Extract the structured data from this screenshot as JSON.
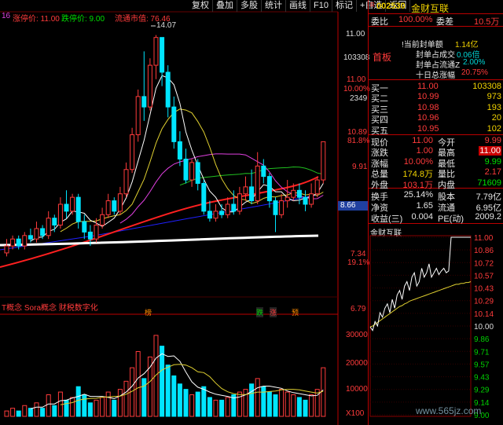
{
  "toolbar": [
    "复权",
    "叠加",
    "多股",
    "统计",
    "画线",
    "F10",
    "标记",
    "+自选",
    "返回"
  ],
  "header": {
    "prefix": "16",
    "limit_up": "涨停价: 11.00",
    "limit_down": "跌停价: 9.00",
    "circ_cap": "流通市值: 76.46"
  },
  "price_axis": {
    "labels": [
      "11.00",
      "103308",
      "11.00",
      "10.00%",
      "2349",
      "10.89",
      "81.8%",
      "9.91",
      "8.66",
      "7.34",
      "19.1%",
      "6.79"
    ]
  },
  "peak_label": "14.07",
  "indicator_text": "T概念 Sora概念 财税数字化",
  "event_markers": [
    "榜",
    "跌",
    "涨",
    "预"
  ],
  "volume_axis": [
    "30000",
    "20000",
    "10000",
    "X100"
  ],
  "colors": {
    "up": "#ff3b3b",
    "down": "#00e5ff",
    "ma5": "#ffffff",
    "ma10": "#e0d030",
    "ma20": "#e040e0",
    "ma60": "#20c020",
    "ma120": "#ff2020",
    "ma250": "#2020ff"
  },
  "chart_data": {
    "type": "candlestick",
    "candles": [
      {
        "o": 7.8,
        "c": 8.0,
        "h": 8.2,
        "l": 7.7
      },
      {
        "o": 8.0,
        "c": 8.2,
        "h": 8.3,
        "l": 7.9
      },
      {
        "o": 8.2,
        "c": 8.0,
        "h": 8.3,
        "l": 7.9
      },
      {
        "o": 8.0,
        "c": 8.3,
        "h": 8.4,
        "l": 7.9
      },
      {
        "o": 8.3,
        "c": 8.2,
        "h": 8.5,
        "l": 8.1
      },
      {
        "o": 8.2,
        "c": 8.5,
        "h": 8.7,
        "l": 8.1
      },
      {
        "o": 8.5,
        "c": 8.3,
        "h": 8.6,
        "l": 8.2
      },
      {
        "o": 8.3,
        "c": 8.8,
        "h": 9.0,
        "l": 8.2
      },
      {
        "o": 8.8,
        "c": 8.6,
        "h": 8.9,
        "l": 8.4
      },
      {
        "o": 8.6,
        "c": 9.2,
        "h": 9.4,
        "l": 8.5
      },
      {
        "o": 9.2,
        "c": 9.0,
        "h": 9.6,
        "l": 8.8
      },
      {
        "o": 9.0,
        "c": 9.4,
        "h": 9.5,
        "l": 8.9
      },
      {
        "o": 9.4,
        "c": 8.7,
        "h": 9.5,
        "l": 8.5
      },
      {
        "o": 8.7,
        "c": 8.4,
        "h": 8.9,
        "l": 8.2
      },
      {
        "o": 8.4,
        "c": 8.2,
        "h": 8.6,
        "l": 8.0
      },
      {
        "o": 8.2,
        "c": 8.6,
        "h": 8.8,
        "l": 8.1
      },
      {
        "o": 8.6,
        "c": 8.9,
        "h": 9.1,
        "l": 8.5
      },
      {
        "o": 8.9,
        "c": 9.3,
        "h": 9.5,
        "l": 8.8
      },
      {
        "o": 9.3,
        "c": 9.0,
        "h": 9.4,
        "l": 8.9
      },
      {
        "o": 9.0,
        "c": 9.5,
        "h": 9.7,
        "l": 8.9
      },
      {
        "o": 9.5,
        "c": 10.2,
        "h": 10.4,
        "l": 9.4
      },
      {
        "o": 10.2,
        "c": 11.2,
        "h": 11.4,
        "l": 10.1
      },
      {
        "o": 11.2,
        "c": 12.3,
        "h": 12.5,
        "l": 11.0
      },
      {
        "o": 12.3,
        "c": 12.0,
        "h": 13.6,
        "l": 11.6
      },
      {
        "o": 12.0,
        "c": 13.2,
        "h": 13.4,
        "l": 11.9
      },
      {
        "o": 13.2,
        "c": 14.0,
        "h": 14.07,
        "l": 12.8
      },
      {
        "o": 14.0,
        "c": 13.0,
        "h": 14.0,
        "l": 12.6
      },
      {
        "o": 13.0,
        "c": 12.0,
        "h": 13.2,
        "l": 11.7
      },
      {
        "o": 12.0,
        "c": 11.0,
        "h": 12.3,
        "l": 10.8
      },
      {
        "o": 11.0,
        "c": 10.5,
        "h": 11.3,
        "l": 10.3
      },
      {
        "o": 10.5,
        "c": 9.9,
        "h": 10.8,
        "l": 9.8
      },
      {
        "o": 9.9,
        "c": 10.4,
        "h": 10.5,
        "l": 9.7
      },
      {
        "o": 10.4,
        "c": 9.8,
        "h": 10.5,
        "l": 9.6
      },
      {
        "o": 9.8,
        "c": 9.0,
        "h": 9.9,
        "l": 8.9
      },
      {
        "o": 9.0,
        "c": 8.8,
        "h": 9.3,
        "l": 8.7
      },
      {
        "o": 8.8,
        "c": 9.0,
        "h": 9.2,
        "l": 8.7
      },
      {
        "o": 9.0,
        "c": 8.9,
        "h": 9.2,
        "l": 8.8
      },
      {
        "o": 8.9,
        "c": 9.2,
        "h": 9.4,
        "l": 8.8
      },
      {
        "o": 9.2,
        "c": 9.0,
        "h": 9.6,
        "l": 8.9
      },
      {
        "o": 9.0,
        "c": 9.5,
        "h": 9.7,
        "l": 8.9
      },
      {
        "o": 9.5,
        "c": 9.7,
        "h": 10.0,
        "l": 9.3
      },
      {
        "o": 9.7,
        "c": 9.3,
        "h": 10.2,
        "l": 9.2
      },
      {
        "o": 9.3,
        "c": 10.3,
        "h": 10.7,
        "l": 9.2
      },
      {
        "o": 10.3,
        "c": 10.0,
        "h": 10.5,
        "l": 9.8
      },
      {
        "o": 10.0,
        "c": 9.3,
        "h": 10.1,
        "l": 9.1
      },
      {
        "o": 9.3,
        "c": 8.9,
        "h": 9.4,
        "l": 8.4
      },
      {
        "o": 8.9,
        "c": 9.3,
        "h": 9.5,
        "l": 8.8
      },
      {
        "o": 9.3,
        "c": 9.4,
        "h": 9.9,
        "l": 9.1
      },
      {
        "o": 9.4,
        "c": 9.6,
        "h": 9.8,
        "l": 9.3
      },
      {
        "o": 9.6,
        "c": 9.4,
        "h": 9.8,
        "l": 9.2
      },
      {
        "o": 9.4,
        "c": 9.2,
        "h": 9.6,
        "l": 9.0
      },
      {
        "o": 9.2,
        "c": 9.5,
        "h": 9.8,
        "l": 9.1
      },
      {
        "o": 9.5,
        "c": 9.9,
        "h": 10.0,
        "l": 9.4
      },
      {
        "o": 9.9,
        "c": 11.0,
        "h": 11.0,
        "l": 9.8
      }
    ],
    "volume": [
      2,
      3,
      2,
      4,
      3,
      5,
      3,
      8,
      4,
      9,
      6,
      7,
      11,
      8,
      5,
      6,
      7,
      9,
      6,
      10,
      13,
      18,
      24,
      14,
      22,
      30,
      26,
      19,
      15,
      12,
      10,
      8,
      9,
      11,
      7,
      6,
      6,
      7,
      8,
      9,
      10,
      12,
      14,
      11,
      9,
      8,
      10,
      9,
      8,
      7,
      6,
      8,
      10,
      18
    ]
  },
  "right": {
    "code": "002530",
    "name": "金财互联",
    "webi_label": "委比",
    "webi_val": "100.00%",
    "weicha_label": "委差",
    "weicha_val": "10.5万",
    "seal_rows": [
      {
        "k": "!当前封单额",
        "v": "1.14亿"
      },
      {
        "k": "封单占成交",
        "v": "0.06倍"
      },
      {
        "k": "封单占流通Z",
        "v": "2.00%"
      },
      {
        "k": "十日总涨幅",
        "v": "20.75%"
      }
    ],
    "board_tag": "首板",
    "buy": [
      {
        "k": "买一",
        "p": "11.00",
        "q": "103308"
      },
      {
        "k": "买二",
        "p": "10.99",
        "q": "973"
      },
      {
        "k": "买三",
        "p": "10.98",
        "q": "193"
      },
      {
        "k": "买四",
        "p": "10.96",
        "q": "20"
      },
      {
        "k": "买五",
        "p": "10.95",
        "q": "102"
      }
    ],
    "stats": [
      {
        "k1": "现价",
        "v1": "11.00",
        "k2": "今开",
        "v2": "9.99"
      },
      {
        "k1": "涨跌",
        "v1": "1.00",
        "k2": "最高",
        "v2": "11.00"
      },
      {
        "k1": "涨幅",
        "v1": "10.00%",
        "k2": "最低",
        "v2": "9.99"
      },
      {
        "k1": "总量",
        "v1": "174.8万",
        "k2": "量比",
        "v2": "2.17"
      },
      {
        "k1": "外盘",
        "v1": "103.1万",
        "k2": "内盘",
        "v2": "71609"
      }
    ],
    "stats2": [
      {
        "k1": "换手",
        "v1": "25.14%",
        "k2": "股本",
        "v2": "7.79亿"
      },
      {
        "k1": "净资",
        "v1": "1.65",
        "k2": "流通",
        "v2": "6.95亿"
      },
      {
        "k1": "收益(三)",
        "v1": "0.004",
        "k2": "PE(动)",
        "v2": "2009.2"
      }
    ],
    "mini_title": "金财互联",
    "mini_axis": [
      "11.00",
      "10.86",
      "10.72",
      "10.57",
      "10.43",
      "10.29",
      "10.14",
      "10.00",
      "9.86",
      "9.71",
      "9.57",
      "9.43",
      "9.29",
      "9.14",
      "9.00"
    ],
    "mini_intraday": [
      9.99,
      9.95,
      10.05,
      10.0,
      10.15,
      10.1,
      10.2,
      10.25,
      10.15,
      10.3,
      10.2,
      10.35,
      10.4,
      10.3,
      10.45,
      10.5,
      10.4,
      10.55,
      10.6,
      10.45,
      10.5,
      10.65,
      10.55,
      10.6,
      10.7,
      10.55,
      10.6,
      10.65,
      10.58,
      10.62,
      10.65,
      10.6,
      10.62,
      11.0,
      11.0,
      11.0,
      11.0,
      11.0,
      11.0,
      11.0,
      11.0,
      11.0
    ],
    "mini_avg": [
      9.99,
      10.0,
      10.02,
      10.04,
      10.06,
      10.08,
      10.1,
      10.12,
      10.14,
      10.16,
      10.18,
      10.2,
      10.22,
      10.23,
      10.25,
      10.26,
      10.28,
      10.29,
      10.3,
      10.31,
      10.32,
      10.33,
      10.34,
      10.35,
      10.36,
      10.37,
      10.38,
      10.39,
      10.4,
      10.41,
      10.42,
      10.43,
      10.44,
      10.45,
      10.46,
      10.47,
      10.47,
      10.48,
      10.48,
      10.49,
      10.49,
      10.5
    ]
  },
  "watermark": "www.565jz.com"
}
